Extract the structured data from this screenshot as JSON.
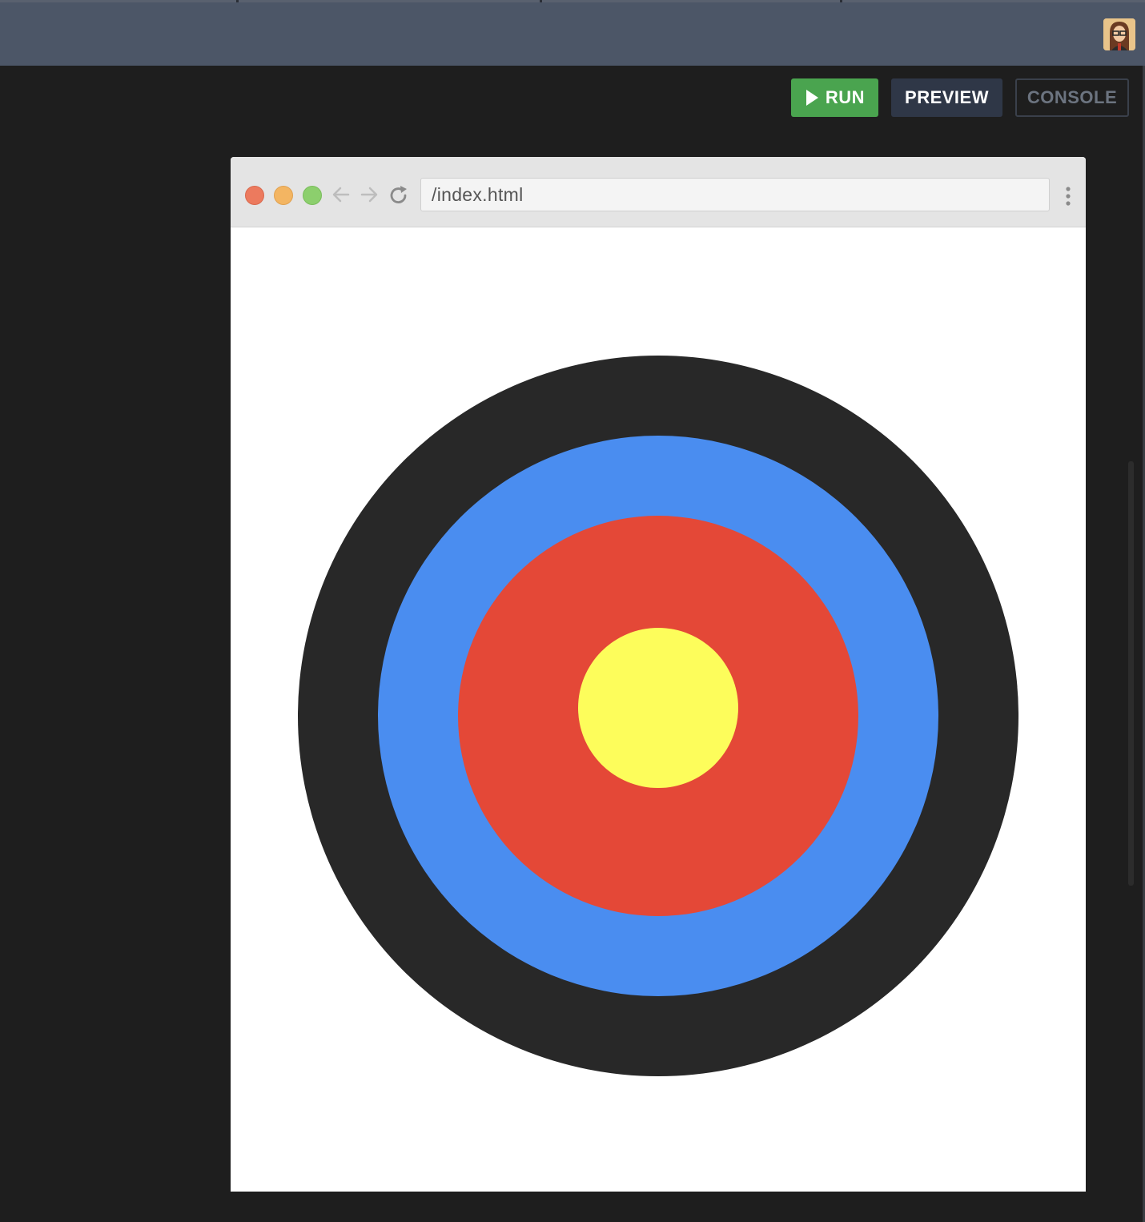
{
  "toolbar": {
    "run_label": "RUN",
    "preview_label": "PREVIEW",
    "console_label": "CONSOLE"
  },
  "browser": {
    "url": "/index.html"
  },
  "target": {
    "colors": {
      "outer": "#282828",
      "second": "#4a8df0",
      "third": "#e44837",
      "center": "#fdfd5b"
    }
  },
  "icons": [
    "play-icon",
    "back-arrow-icon",
    "forward-arrow-icon",
    "reload-icon",
    "more-vertical-icon",
    "user-avatar"
  ]
}
